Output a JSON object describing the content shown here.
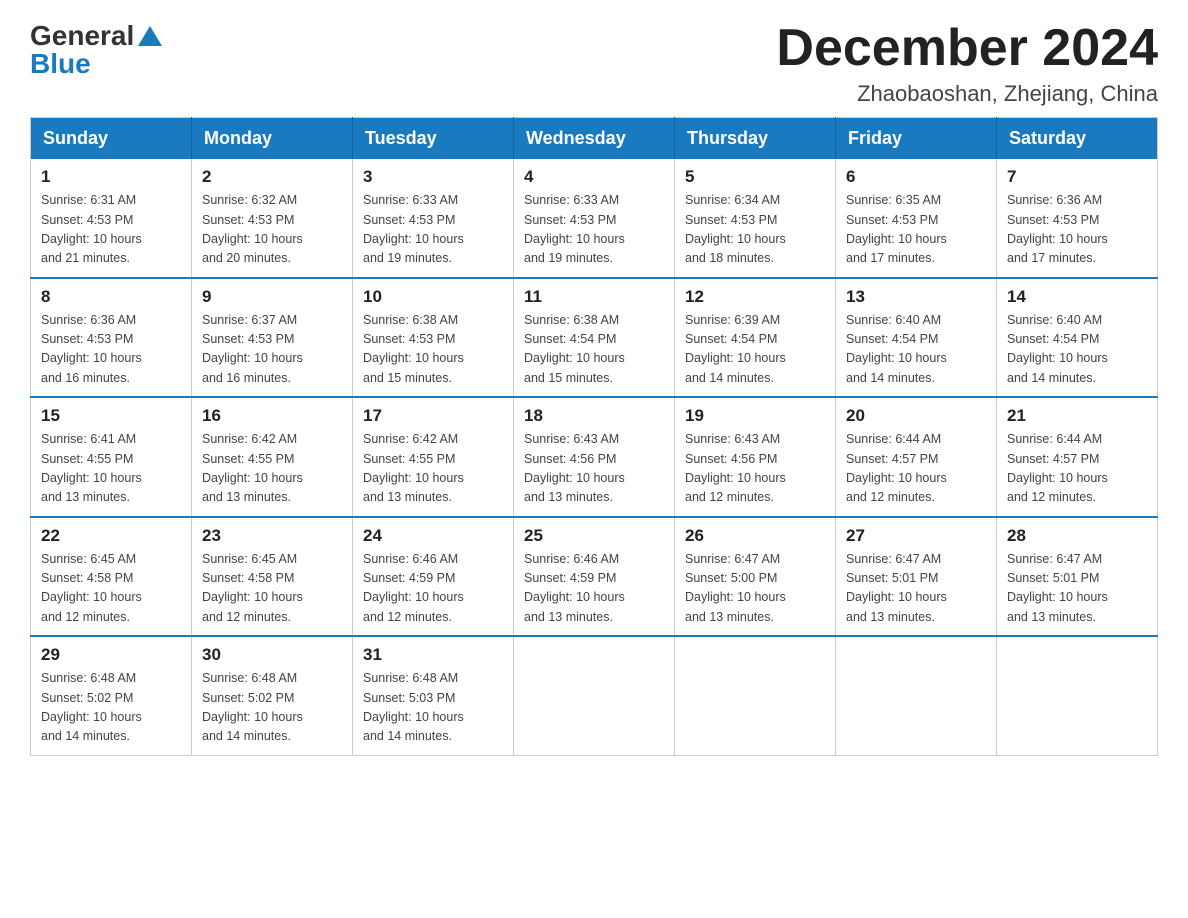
{
  "header": {
    "logo_general": "General",
    "logo_blue": "Blue",
    "month_title": "December 2024",
    "location": "Zhaobaoshan, Zhejiang, China"
  },
  "days_of_week": [
    "Sunday",
    "Monday",
    "Tuesday",
    "Wednesday",
    "Thursday",
    "Friday",
    "Saturday"
  ],
  "weeks": [
    [
      {
        "day": "1",
        "sunrise": "6:31 AM",
        "sunset": "4:53 PM",
        "daylight": "10 hours and 21 minutes."
      },
      {
        "day": "2",
        "sunrise": "6:32 AM",
        "sunset": "4:53 PM",
        "daylight": "10 hours and 20 minutes."
      },
      {
        "day": "3",
        "sunrise": "6:33 AM",
        "sunset": "4:53 PM",
        "daylight": "10 hours and 19 minutes."
      },
      {
        "day": "4",
        "sunrise": "6:33 AM",
        "sunset": "4:53 PM",
        "daylight": "10 hours and 19 minutes."
      },
      {
        "day": "5",
        "sunrise": "6:34 AM",
        "sunset": "4:53 PM",
        "daylight": "10 hours and 18 minutes."
      },
      {
        "day": "6",
        "sunrise": "6:35 AM",
        "sunset": "4:53 PM",
        "daylight": "10 hours and 17 minutes."
      },
      {
        "day": "7",
        "sunrise": "6:36 AM",
        "sunset": "4:53 PM",
        "daylight": "10 hours and 17 minutes."
      }
    ],
    [
      {
        "day": "8",
        "sunrise": "6:36 AM",
        "sunset": "4:53 PM",
        "daylight": "10 hours and 16 minutes."
      },
      {
        "day": "9",
        "sunrise": "6:37 AM",
        "sunset": "4:53 PM",
        "daylight": "10 hours and 16 minutes."
      },
      {
        "day": "10",
        "sunrise": "6:38 AM",
        "sunset": "4:53 PM",
        "daylight": "10 hours and 15 minutes."
      },
      {
        "day": "11",
        "sunrise": "6:38 AM",
        "sunset": "4:54 PM",
        "daylight": "10 hours and 15 minutes."
      },
      {
        "day": "12",
        "sunrise": "6:39 AM",
        "sunset": "4:54 PM",
        "daylight": "10 hours and 14 minutes."
      },
      {
        "day": "13",
        "sunrise": "6:40 AM",
        "sunset": "4:54 PM",
        "daylight": "10 hours and 14 minutes."
      },
      {
        "day": "14",
        "sunrise": "6:40 AM",
        "sunset": "4:54 PM",
        "daylight": "10 hours and 14 minutes."
      }
    ],
    [
      {
        "day": "15",
        "sunrise": "6:41 AM",
        "sunset": "4:55 PM",
        "daylight": "10 hours and 13 minutes."
      },
      {
        "day": "16",
        "sunrise": "6:42 AM",
        "sunset": "4:55 PM",
        "daylight": "10 hours and 13 minutes."
      },
      {
        "day": "17",
        "sunrise": "6:42 AM",
        "sunset": "4:55 PM",
        "daylight": "10 hours and 13 minutes."
      },
      {
        "day": "18",
        "sunrise": "6:43 AM",
        "sunset": "4:56 PM",
        "daylight": "10 hours and 13 minutes."
      },
      {
        "day": "19",
        "sunrise": "6:43 AM",
        "sunset": "4:56 PM",
        "daylight": "10 hours and 12 minutes."
      },
      {
        "day": "20",
        "sunrise": "6:44 AM",
        "sunset": "4:57 PM",
        "daylight": "10 hours and 12 minutes."
      },
      {
        "day": "21",
        "sunrise": "6:44 AM",
        "sunset": "4:57 PM",
        "daylight": "10 hours and 12 minutes."
      }
    ],
    [
      {
        "day": "22",
        "sunrise": "6:45 AM",
        "sunset": "4:58 PM",
        "daylight": "10 hours and 12 minutes."
      },
      {
        "day": "23",
        "sunrise": "6:45 AM",
        "sunset": "4:58 PM",
        "daylight": "10 hours and 12 minutes."
      },
      {
        "day": "24",
        "sunrise": "6:46 AM",
        "sunset": "4:59 PM",
        "daylight": "10 hours and 12 minutes."
      },
      {
        "day": "25",
        "sunrise": "6:46 AM",
        "sunset": "4:59 PM",
        "daylight": "10 hours and 13 minutes."
      },
      {
        "day": "26",
        "sunrise": "6:47 AM",
        "sunset": "5:00 PM",
        "daylight": "10 hours and 13 minutes."
      },
      {
        "day": "27",
        "sunrise": "6:47 AM",
        "sunset": "5:01 PM",
        "daylight": "10 hours and 13 minutes."
      },
      {
        "day": "28",
        "sunrise": "6:47 AM",
        "sunset": "5:01 PM",
        "daylight": "10 hours and 13 minutes."
      }
    ],
    [
      {
        "day": "29",
        "sunrise": "6:48 AM",
        "sunset": "5:02 PM",
        "daylight": "10 hours and 14 minutes."
      },
      {
        "day": "30",
        "sunrise": "6:48 AM",
        "sunset": "5:02 PM",
        "daylight": "10 hours and 14 minutes."
      },
      {
        "day": "31",
        "sunrise": "6:48 AM",
        "sunset": "5:03 PM",
        "daylight": "10 hours and 14 minutes."
      },
      null,
      null,
      null,
      null
    ]
  ],
  "labels": {
    "sunrise": "Sunrise:",
    "sunset": "Sunset:",
    "daylight": "Daylight:"
  }
}
